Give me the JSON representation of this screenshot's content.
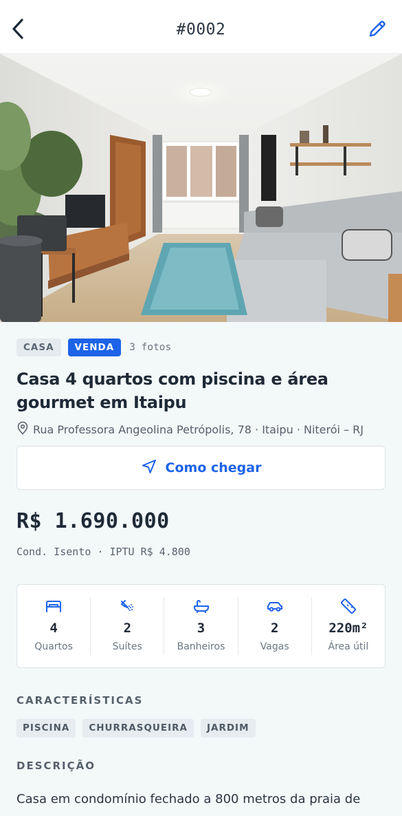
{
  "header": {
    "code": "#0002",
    "back_icon": "chevron-left-icon",
    "edit_icon": "pencil-icon"
  },
  "photo": {
    "description_icon": "living-room-photo"
  },
  "listing": {
    "type_badge": "CASA",
    "deal_badge": "VENDA",
    "photos_count": "3 fotos",
    "title": "Casa 4 quartos com piscina e área gourmet em Itaipu",
    "address": "Rua Professora Angeolina Petrópolis, 78 · Itaipu · Niterói – RJ",
    "route_label": "Como chegar",
    "price": "R$ 1.690.000",
    "fees": "Cond. Isento · IPTU R$ 4.800"
  },
  "stats": [
    {
      "icon": "bed-icon",
      "value": "4",
      "label": "Quartos"
    },
    {
      "icon": "shower-icon",
      "value": "2",
      "label": "Suítes"
    },
    {
      "icon": "bathtub-icon",
      "value": "3",
      "label": "Banheiros"
    },
    {
      "icon": "car-icon",
      "value": "2",
      "label": "Vagas"
    },
    {
      "icon": "ruler-icon",
      "value": "220m²",
      "label": "Área útil"
    }
  ],
  "features": {
    "title": "CARACTERÍSTICAS",
    "items": [
      "PISCINA",
      "CHURRASQUEIRA",
      "JARDIM"
    ]
  },
  "description": {
    "title": "DESCRIÇÃO",
    "text": "Casa em condomínio fechado a 800 metros da praia de"
  },
  "colors": {
    "accent": "#1d63e8",
    "background": "#f3f8f9",
    "text": "#1f2a37"
  }
}
